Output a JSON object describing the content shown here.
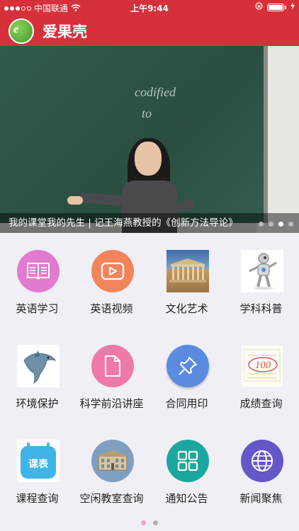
{
  "status_bar": {
    "carrier": "中国联通",
    "time": "上午9:44"
  },
  "app": {
    "title": "爱果壳",
    "logo_text": "e"
  },
  "banner": {
    "caption": "我的课堂我的先生 | 记王海燕教授的《创新方法导论》",
    "chalk_text_1": "codified",
    "chalk_text_2": "to",
    "slide_count": 4,
    "active_slide": 3
  },
  "grid": {
    "items": [
      {
        "label": "英语学习",
        "icon": "book-icon",
        "color": "#e27bd0"
      },
      {
        "label": "英语视频",
        "icon": "play-icon",
        "color": "#f2845c"
      },
      {
        "label": "文化艺术",
        "icon": "parthenon-photo-icon",
        "color": "#b88e55"
      },
      {
        "label": "学科科普",
        "icon": "robot-icon",
        "color": "#cccccc"
      },
      {
        "label": "环境保护",
        "icon": "dolphin-icon",
        "color": "#7aa0b4"
      },
      {
        "label": "科学前沿讲座",
        "icon": "document-icon",
        "color": "#ef79a8"
      },
      {
        "label": "合同用印",
        "icon": "pushpin-icon",
        "color": "#5a8be0"
      },
      {
        "label": "成绩查询",
        "icon": "score-paper-icon",
        "color": "#e9c46a"
      },
      {
        "label": "课程查询",
        "icon": "calendar-icon",
        "color": "#3fb4e6"
      },
      {
        "label": "空闲教室查询",
        "icon": "building-icon",
        "color": "#7f9fc0"
      },
      {
        "label": "通知公告",
        "icon": "grid-icon",
        "color": "#1aa79e"
      },
      {
        "label": "新闻聚焦",
        "icon": "globe-icon",
        "color": "#6457c8"
      }
    ],
    "schedule_icon_text": "课表",
    "score_icon_text": "100"
  },
  "pager": {
    "page_count": 2,
    "active_page": 1
  }
}
